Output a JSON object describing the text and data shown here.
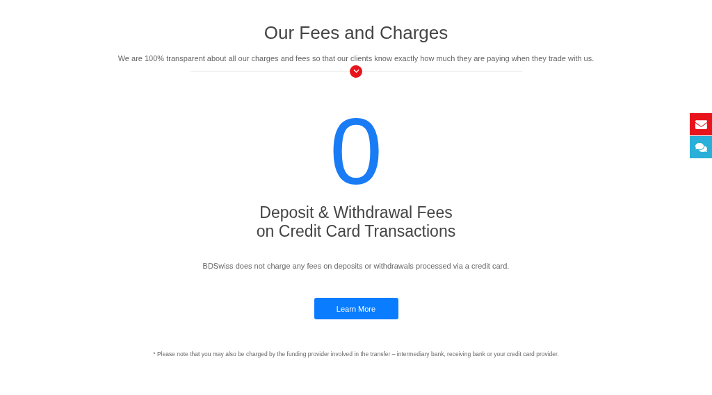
{
  "header": {
    "title": "Our Fees and Charges",
    "subtitle": "We are 100% transparent about all our charges and fees so that our clients know exactly how much they are paying when they trade with us."
  },
  "feature": {
    "figure": "0",
    "heading_lines": [
      "Deposit & Withdrawal Fees",
      "on Credit Card Transactions"
    ],
    "description": "BDSwiss does not charge any fees on deposits or withdrawals processed via a credit card.",
    "button": "Learn More"
  },
  "footnote": "* Please note that you may also be charged by the funding provider involved in the transfer – intermediary bank, receiving bank or your credit card provider.",
  "side_buttons": [
    {
      "kind": "email",
      "color": "#e8141c"
    },
    {
      "kind": "chat",
      "color": "#2aafd8"
    }
  ]
}
